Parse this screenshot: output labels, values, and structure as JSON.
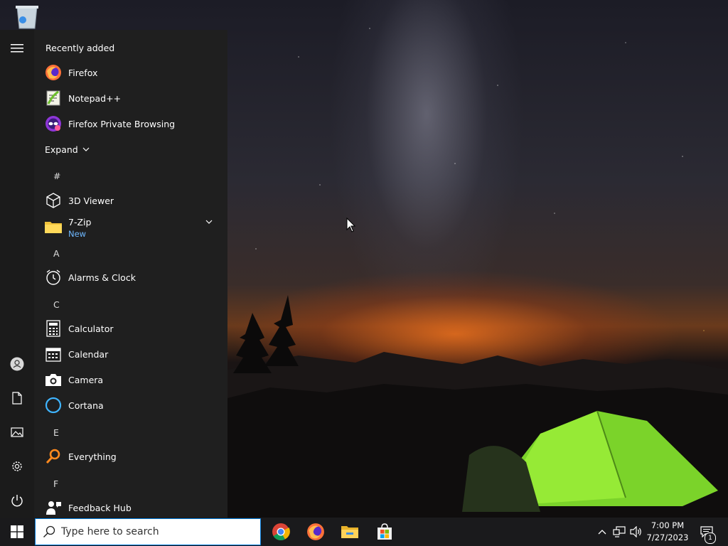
{
  "start_menu": {
    "recently_added_heading": "Recently added",
    "recent_items": [
      {
        "label": "Firefox",
        "icon": "firefox-icon"
      },
      {
        "label": "Notepad++",
        "icon": "notepadpp-icon"
      },
      {
        "label": "Firefox Private Browsing",
        "icon": "firefox-private-icon"
      }
    ],
    "expand_label": "Expand",
    "sections": {
      "hash": "#",
      "a": "A",
      "c": "C",
      "e": "E",
      "f": "F"
    },
    "apps": {
      "viewer3d": "3D Viewer",
      "sevenzip": "7-Zip",
      "sevenzip_badge": "New",
      "alarms": "Alarms & Clock",
      "calculator": "Calculator",
      "calendar": "Calendar",
      "camera": "Camera",
      "cortana": "Cortana",
      "everything": "Everything",
      "feedback": "Feedback Hub"
    }
  },
  "taskbar": {
    "search_placeholder": "Type here to search",
    "pinned": [
      "chrome-icon",
      "firefox-icon",
      "file-explorer-icon",
      "microsoft-store-icon"
    ],
    "time": "7:00 PM",
    "date": "7/27/2023",
    "notification_count": "1"
  },
  "colors": {
    "accent": "#0078d7",
    "new_badge": "#6eb8ff",
    "start_menu_bg": "#1f1f1f",
    "taskbar_bg": "#1a1a1c"
  }
}
